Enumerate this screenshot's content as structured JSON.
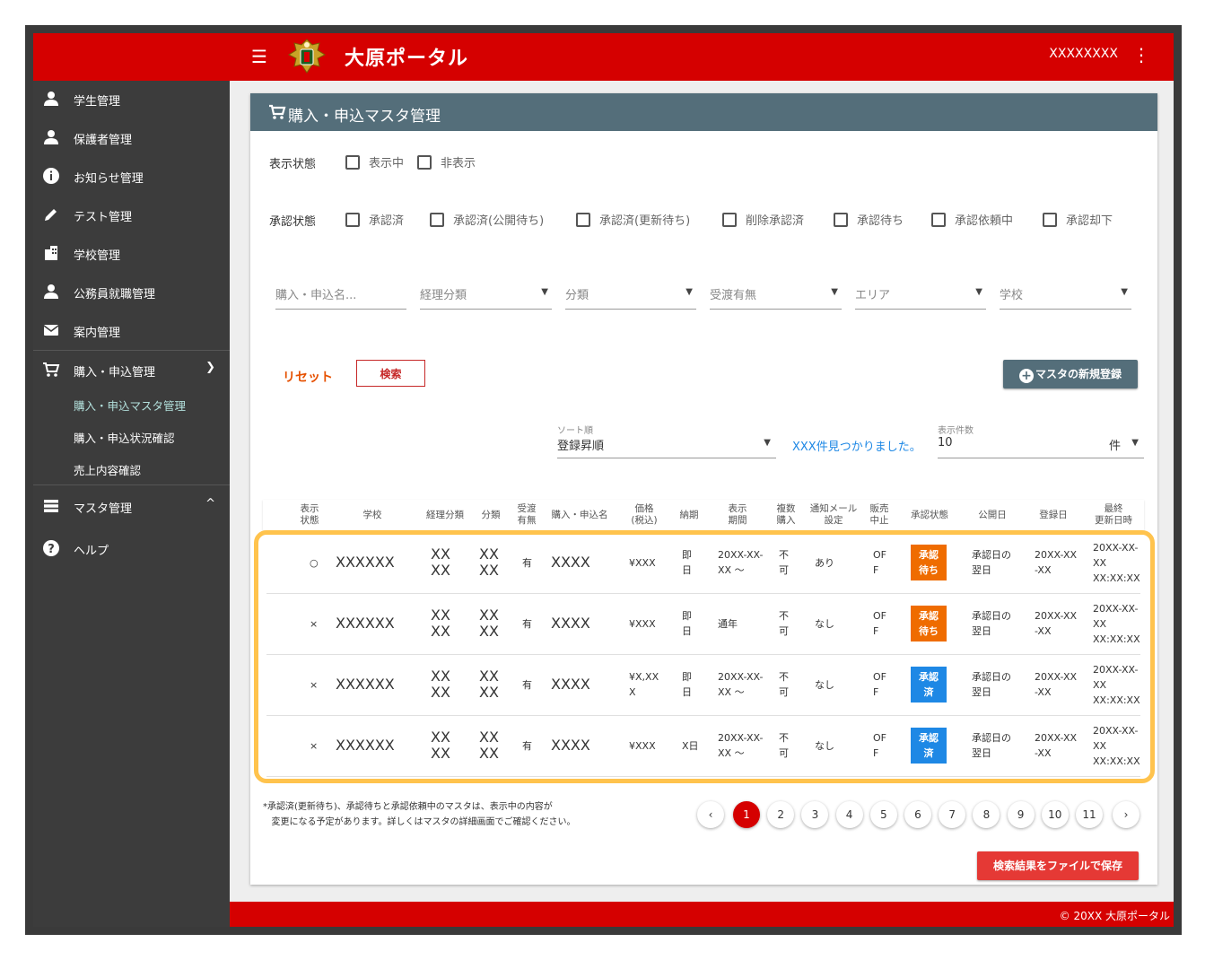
{
  "app": {
    "title": "大原ポータル",
    "user": "XXXXXXXX",
    "footer": "© 20XX 大原ポータル",
    "brand_color": "#d50000"
  },
  "sidebar": {
    "items": [
      {
        "label": "学生管理",
        "icon": "person-icon"
      },
      {
        "label": "保護者管理",
        "icon": "person-icon"
      },
      {
        "label": "お知らせ管理",
        "icon": "info-icon"
      },
      {
        "label": "テスト管理",
        "icon": "pencil-icon"
      },
      {
        "label": "学校管理",
        "icon": "building-icon"
      },
      {
        "label": "公務員就職管理",
        "icon": "person-icon"
      },
      {
        "label": "案内管理",
        "icon": "mail-icon"
      },
      {
        "label": "購入・申込管理",
        "icon": "cart-icon"
      }
    ],
    "sub_items": [
      "購入・申込マスタ管理",
      "購入・申込状況確認",
      "売上内容確認"
    ],
    "master": {
      "label": "マスタ管理",
      "icon": "list-icon"
    },
    "help": {
      "label": "ヘルプ",
      "icon": "help-icon"
    }
  },
  "page": {
    "title": "購入・申込マスタ管理",
    "display_state_label": "表示状態",
    "display_state_options": [
      "表示中",
      "非表示"
    ],
    "approval_state_label": "承認状態",
    "approval_state_options": [
      "承認済",
      "承認済(公開待ち)",
      "承認済(更新待ち)",
      "削除承認済",
      "承認待ち",
      "承認依頼中",
      "承認却下"
    ],
    "filters": {
      "name_placeholder": "購入・申込名...",
      "accounting": "経理分類",
      "category": "分類",
      "delivery": "受渡有無",
      "area": "エリア",
      "school": "学校"
    },
    "reset_label": "リセット",
    "search_label": "検索",
    "new_master_label": "マスタの新規登録",
    "sort_label": "ソート順",
    "sort_value": "登録昇順",
    "found_text": "XXX件見つかりました。",
    "per_page_label": "表示件数",
    "per_page_value": "10",
    "per_page_unit": "件",
    "save_label": "検索結果をファイルで保存",
    "note_line1": "*承認済(更新待ち)、承認待ちと承認依頼中のマスタは、表示中の内容が",
    "note_line2": "変更になる予定があります。詳しくはマスタの詳細画面でご確認ください。"
  },
  "table": {
    "headers": {
      "display_state": [
        "表示",
        "状態"
      ],
      "school": "学校",
      "accounting": "経理分類",
      "category": "分類",
      "delivery": [
        "受渡",
        "有無"
      ],
      "name": "購入・申込名",
      "price": [
        "価格",
        "(税込)"
      ],
      "delivery_date": "納期",
      "period": [
        "表示",
        "期間"
      ],
      "multi": [
        "複数",
        "購入"
      ],
      "mail": [
        "通知メール",
        "設定"
      ],
      "stop": [
        "販売",
        "中止"
      ],
      "approval": "承認状態",
      "publish": "公開日",
      "registered": "登録日",
      "updated": [
        "最終",
        "更新日時"
      ]
    },
    "rows": [
      {
        "state": "○",
        "school": "XXXXXX",
        "accounting": [
          "XX",
          "XX"
        ],
        "category": [
          "XX",
          "XX"
        ],
        "delivery": "有",
        "name": "XXXX",
        "price": [
          "¥XXX"
        ],
        "delivery_date": [
          "即",
          "日"
        ],
        "period": [
          "20XX-XX-",
          "XX ～"
        ],
        "multi": [
          "不",
          "可"
        ],
        "mail": "あり",
        "stop": [
          "OF",
          "F"
        ],
        "approval": [
          "承認",
          "待ち"
        ],
        "approval_color": "#ef6c00",
        "publish": [
          "承認日の",
          "翌日"
        ],
        "registered": [
          "20XX-XX",
          "-XX"
        ],
        "updated": [
          "20XX-XX-",
          "XX",
          "XX:XX:XX"
        ]
      },
      {
        "state": "×",
        "school": "XXXXXX",
        "accounting": [
          "XX",
          "XX"
        ],
        "category": [
          "XX",
          "XX"
        ],
        "delivery": "有",
        "name": "XXXX",
        "price": [
          "¥XXX"
        ],
        "delivery_date": [
          "即",
          "日"
        ],
        "period": [
          "通年"
        ],
        "multi": [
          "不",
          "可"
        ],
        "mail": "なし",
        "stop": [
          "OF",
          "F"
        ],
        "approval": [
          "承認",
          "待ち"
        ],
        "approval_color": "#ef6c00",
        "publish": [
          "承認日の",
          "翌日"
        ],
        "registered": [
          "20XX-XX",
          "-XX"
        ],
        "updated": [
          "20XX-XX-",
          "XX",
          "XX:XX:XX"
        ]
      },
      {
        "state": "×",
        "school": "XXXXXX",
        "accounting": [
          "XX",
          "XX"
        ],
        "category": [
          "XX",
          "XX"
        ],
        "delivery": "有",
        "name": "XXXX",
        "price": [
          "¥X,XX",
          "X"
        ],
        "delivery_date": [
          "即",
          "日"
        ],
        "period": [
          "20XX-XX-",
          "XX ～"
        ],
        "multi": [
          "不",
          "可"
        ],
        "mail": "なし",
        "stop": [
          "OF",
          "F"
        ],
        "approval": [
          "承認",
          "済"
        ],
        "approval_color": "#1e88e5",
        "publish": [
          "承認日の",
          "翌日"
        ],
        "registered": [
          "20XX-XX",
          "-XX"
        ],
        "updated": [
          "20XX-XX-",
          "XX",
          "XX:XX:XX"
        ]
      },
      {
        "state": "×",
        "school": "XXXXXX",
        "accounting": [
          "XX",
          "XX"
        ],
        "category": [
          "XX",
          "XX"
        ],
        "delivery": "有",
        "name": "XXXX",
        "price": [
          "¥XXX"
        ],
        "delivery_date": [
          "X日"
        ],
        "period": [
          "20XX-XX-",
          "XX ～"
        ],
        "multi": [
          "不",
          "可"
        ],
        "mail": "なし",
        "stop": [
          "OF",
          "F"
        ],
        "approval": [
          "承認",
          "済"
        ],
        "approval_color": "#1e88e5",
        "publish": [
          "承認日の",
          "翌日"
        ],
        "registered": [
          "20XX-XX",
          "-XX"
        ],
        "updated": [
          "20XX-XX-",
          "XX",
          "XX:XX:XX"
        ]
      }
    ]
  },
  "pagination": {
    "prev": "‹",
    "next": "›",
    "pages": [
      "1",
      "2",
      "3",
      "4",
      "5",
      "6",
      "7",
      "8",
      "9",
      "10",
      "11"
    ],
    "current": "1"
  }
}
